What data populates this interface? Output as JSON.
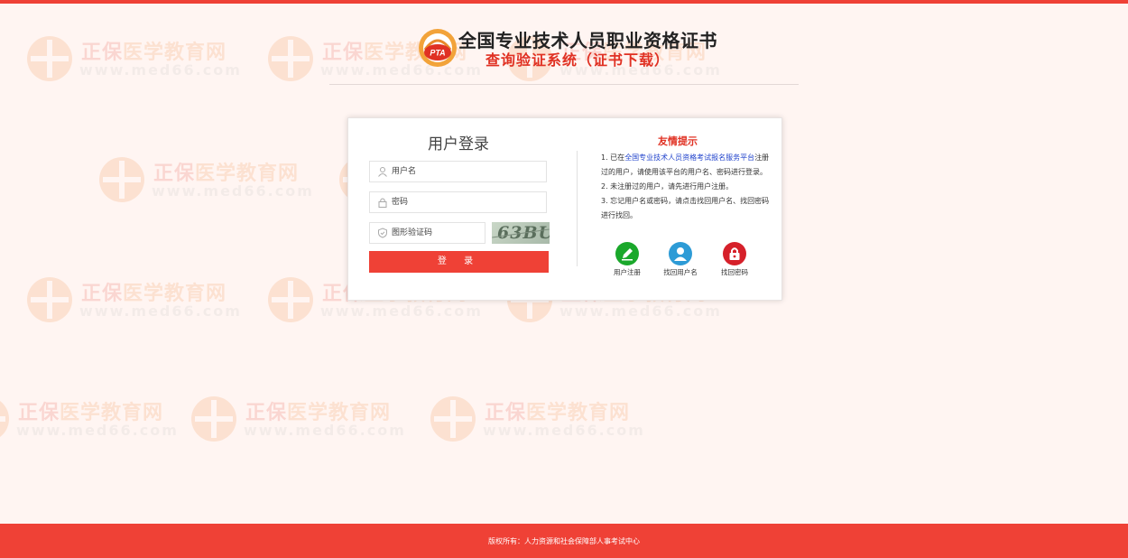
{
  "header": {
    "logo_text": "PTA",
    "title": "全国专业技术人员职业资格证书",
    "subtitle": "查询验证系统（证书下载）"
  },
  "watermark": {
    "brand_a": "正保",
    "brand_b": "医学教育网",
    "url": "www.med66.com"
  },
  "login": {
    "title": "用户登录",
    "username_placeholder": "用户名",
    "password_placeholder": "密码",
    "captcha_placeholder": "图形验证码",
    "captcha_code": "63BU",
    "submit_label": "登 录"
  },
  "tips": {
    "title": "友情提示",
    "item1_prefix": "1. 已在",
    "item1_link": "全国专业技术人员资格考试报名服务平台",
    "item1_suffix": "注册过的用户，请使用该平台的用户名、密码进行登录。",
    "item2": "2. 未注册过的用户，请先进行用户注册。",
    "item3": "3. 忘记用户名或密码，请点击找回用户名、找回密码进行找回。"
  },
  "actions": [
    {
      "label": "用户注册",
      "icon": "pencil-icon",
      "color": "#1aa82b"
    },
    {
      "label": "找回用户名",
      "icon": "user-icon",
      "color": "#2d9bd6"
    },
    {
      "label": "找回密码",
      "icon": "lock-icon",
      "color": "#d6202a"
    }
  ],
  "footer": {
    "text": "版权所有：人力资源和社会保障部人事考试中心"
  },
  "colors": {
    "accent": "#ef4136",
    "background": "#fff5f2"
  }
}
